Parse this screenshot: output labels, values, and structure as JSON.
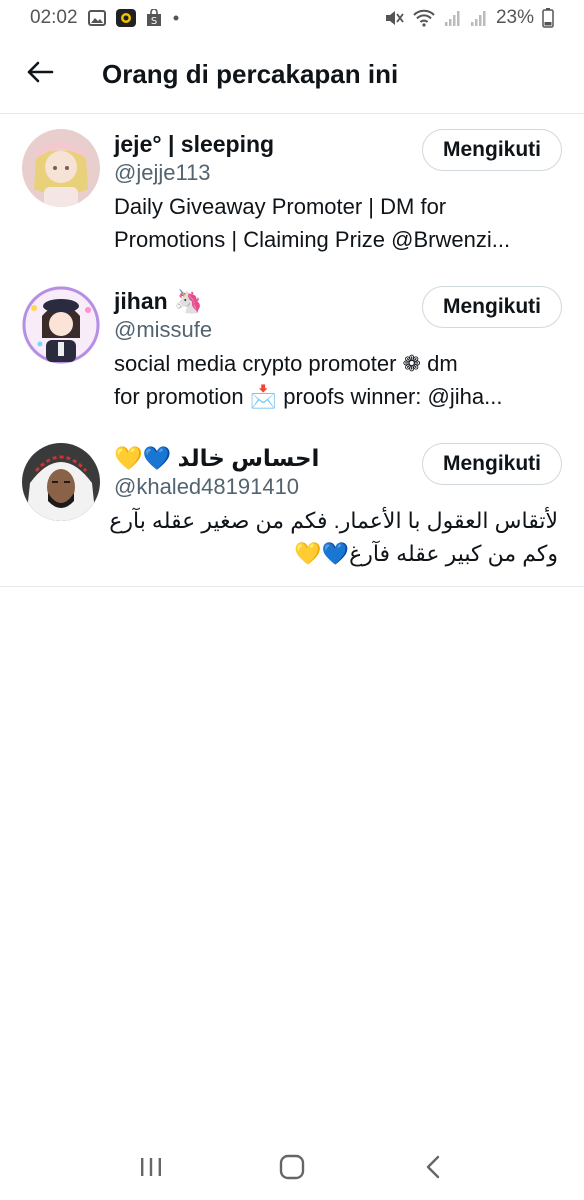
{
  "status_bar": {
    "time": "02:02",
    "battery": "23%"
  },
  "header": {
    "title": "Orang di percakapan ini"
  },
  "users": [
    {
      "display_name": "jeje° | sleeping",
      "handle": "@jejje113",
      "follow_label": "Mengikuti",
      "bio_lines": [
        "Daily Giveaway Promoter | DM for",
        "Promotions | Claiming Prize @Brwenzi..."
      ]
    },
    {
      "display_name": "jihan 🦄",
      "handle": "@missufe",
      "follow_label": "Mengikuti",
      "bio_lines": [
        "social media crypto promoter ❁ dm",
        "for promotion 📩 proofs winner: @jiha..."
      ]
    },
    {
      "display_name": "احساس خالد 💙💛",
      "handle": "@khaled48191410",
      "follow_label": "Mengikuti",
      "bio_lines": [
        "لأتقاس العقول با الأعمار. فكم من صغير عقله بآرع",
        "وكم من كبير عقله فآرغ💙💛"
      ]
    }
  ],
  "icons": {
    "back": "arrow-left-icon",
    "nav_recent": "recent-apps-icon",
    "nav_home": "home-icon",
    "nav_back": "nav-back-icon"
  },
  "colors": {
    "text_primary": "#0f1419",
    "text_secondary": "#536471",
    "divider": "#e6e9ec"
  }
}
